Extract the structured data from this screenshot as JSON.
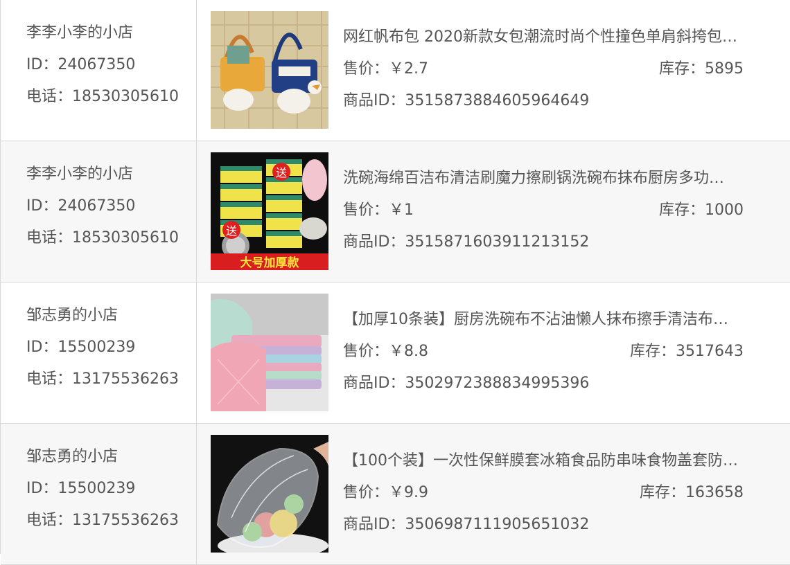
{
  "rows": [
    {
      "shop_name": "李李小李的小店",
      "shop_id": "ID：24067350",
      "phone": "电话：18530305610",
      "product_name": "网红帆布包 2020新款女包潮流时尚个性撞色单肩斜挎包…",
      "price": "售价：￥2.7",
      "stock": "库存：5895",
      "product_id": "商品ID：3515873884605964649",
      "image": "canvas-duck-bag-photo"
    },
    {
      "shop_name": "李李小李的小店",
      "shop_id": "ID：24067350",
      "phone": "电话：18530305610",
      "product_name": "洗碗海绵百洁布清洁刷魔力擦刷锅洗碗布抹布厨房多功…",
      "price": "售价：￥1",
      "stock": "库存：1000",
      "product_id": "商品ID：3515871603911213152",
      "image": "sponge-scrubber-photo",
      "image_text": {
        "gift1": "送",
        "gift2": "送",
        "banner": "大号加厚款"
      }
    },
    {
      "shop_name": "邹志勇的小店",
      "shop_id": "ID：15500239",
      "phone": "电话：13175536263",
      "product_name": "【加厚10条装】厨房洗碗布不沾油懒人抹布擦手清洁布…",
      "price": "售价：￥8.8",
      "stock": "库存：3517643",
      "product_id": "商品ID：3502972388834995396",
      "image": "dish-cloths-photo"
    },
    {
      "shop_name": "邹志勇的小店",
      "shop_id": "ID：15500239",
      "phone": "电话：13175536263",
      "product_name": "【100个装】一次性保鲜膜套冰箱食品防串味食物盖套防…",
      "price": "售价：￥9.9",
      "stock": "库存：163658",
      "product_id": "商品ID：3506987111905651032",
      "image": "food-cover-wrap-photo"
    }
  ],
  "colors": {
    "text": "#555555",
    "row_alt_bg": "#f7f7f7",
    "border": "#d8d8d8",
    "banner_red": "#e02020"
  }
}
